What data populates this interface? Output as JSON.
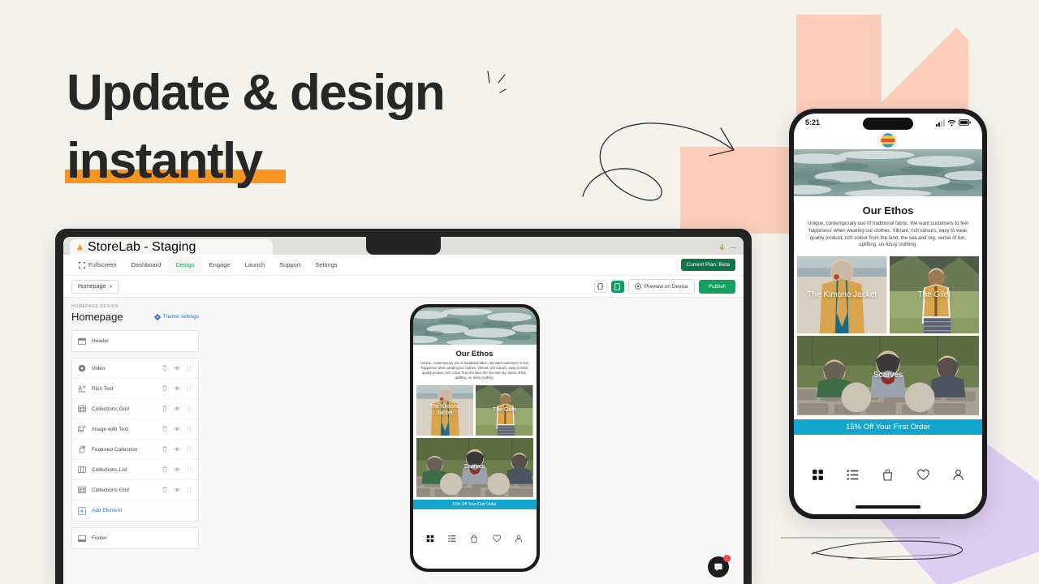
{
  "headline": {
    "line1": "Update & design",
    "line2": "instantly",
    "underline_color": "#f89521",
    "text_color": "#272727"
  },
  "page": {
    "background_color": "#f4f2ed"
  },
  "decor": {
    "cross_color": "#fbcdba",
    "polygon_color": "#ddcdf0",
    "doodle_color": "#2b2b2b"
  },
  "browser": {
    "tab_title": "StoreLab - Staging",
    "favicon": "warning-triangle-icon",
    "download_icon": "download-icon",
    "overflow_icon": "kebab-menu-icon"
  },
  "appnav": {
    "items": [
      {
        "label": "Fullscreen",
        "icon": "fullscreen-icon",
        "active": false
      },
      {
        "label": "Dashboard",
        "icon": "",
        "active": false
      },
      {
        "label": "Design",
        "icon": "",
        "active": true
      },
      {
        "label": "Engage",
        "icon": "",
        "active": false
      },
      {
        "label": "Launch",
        "icon": "",
        "active": false
      },
      {
        "label": "Support",
        "icon": "",
        "active": false
      },
      {
        "label": "Settings",
        "icon": "",
        "active": false
      }
    ],
    "plan_badge": "Current Plan: Beta",
    "active_color": "#1b9e62",
    "badge_color": "#11734b"
  },
  "subtoolbar": {
    "page_select_label": "Homepage",
    "page_select_caret": "▾",
    "responsive_icon": "responsive-width-icon",
    "mobile_icon": "mobile-device-icon",
    "preview_label": "Preview on Device",
    "preview_icon": "eye-target-icon",
    "publish_label": "Publish",
    "publish_color": "#12a061"
  },
  "sidebar": {
    "eyebrow": "HOMEPAGE DESIGN",
    "title": "Homepage",
    "theme_settings_label": "Theme settings",
    "theme_settings_icon": "gear-icon",
    "theme_link_color": "#2f6fd0",
    "header_section": {
      "label": "Header",
      "icon": "header-layout-icon"
    },
    "elements": [
      {
        "label": "Video",
        "icon": "video-icon"
      },
      {
        "label": "Rich Text",
        "icon": "rich-text-icon"
      },
      {
        "label": "Collections Grid",
        "icon": "grid-layout-icon"
      },
      {
        "label": "Image with Text",
        "icon": "image-text-icon"
      },
      {
        "label": "Featured Collection",
        "icon": "featured-collection-icon"
      },
      {
        "label": "Collections List",
        "icon": "columns-icon"
      },
      {
        "label": "Collections Grid",
        "icon": "grid-layout-icon"
      }
    ],
    "row_actions": [
      "trash-icon",
      "eye-icon",
      "drag-handle-icon"
    ],
    "add_element_label": "Add Element",
    "add_element_icon": "add-box-icon",
    "footer_section": {
      "label": "Footer",
      "icon": "footer-layout-icon"
    }
  },
  "phone": {
    "status_time": "5:21",
    "status_icons": [
      "cellular-signal-icon",
      "wifi-icon",
      "battery-icon"
    ],
    "brand_logo": "striped-circle-logo",
    "ethos_title": "Our Ethos",
    "ethos_body": "Unique, contemporary use of traditional fabric. We want customers to feel 'happiness' when wearing our clothes. Vibrant, rich colours, easy to wear, quality product, rich colour from the land, the sea and sky, sense of fun, uplifting, un-fussy clothing.",
    "tiles": [
      {
        "label": "The Kimono Jacket"
      },
      {
        "label": "The Gilet"
      },
      {
        "label": "Scarves"
      }
    ],
    "promo_banner": "15% Off Your First Order",
    "promo_color": "#12a5cd",
    "bottom_nav": [
      "grid-icon",
      "list-icon",
      "shopping-bag-icon",
      "heart-icon",
      "person-icon"
    ]
  },
  "chat": {
    "icon": "chat-bubble-icon",
    "badge_count": "1",
    "badge_color": "#f23e3e"
  }
}
